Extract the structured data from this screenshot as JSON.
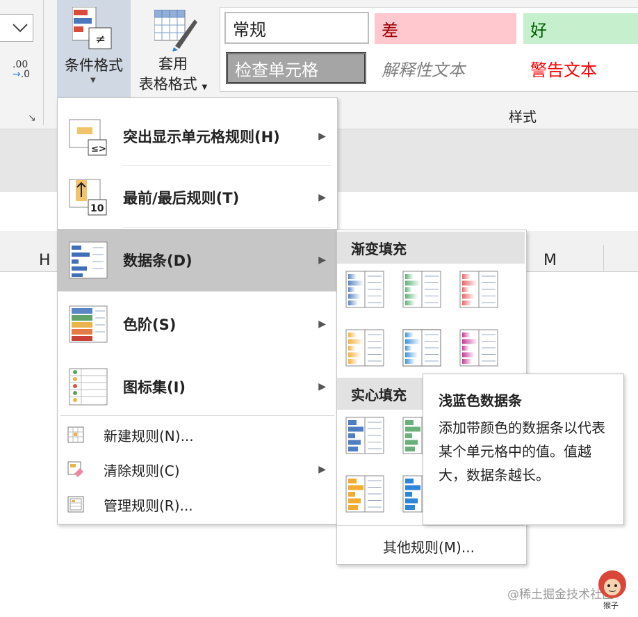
{
  "ribbon": {
    "cond_format_label": "条件格式",
    "table_format_line1": "套用",
    "table_format_line2": "表格格式",
    "styles_group_label": "样式",
    "decimal_label": ".00",
    "decimal_label2": ".0",
    "styles": {
      "normal": "常规",
      "bad": "差",
      "good": "好",
      "check_cell": "检查单元格",
      "explanatory": "解释性文本",
      "warning": "警告文本"
    }
  },
  "sheet": {
    "columns": [
      "H",
      "M"
    ]
  },
  "menu": {
    "items": [
      {
        "label": "突出显示单元格规则(H)",
        "icon": "highlight-cells-rules-icon"
      },
      {
        "label": "最前/最后规则(T)",
        "icon": "top-bottom-rules-icon"
      },
      {
        "label": "数据条(D)",
        "icon": "data-bars-icon"
      },
      {
        "label": "色阶(S)",
        "icon": "color-scales-icon"
      },
      {
        "label": "图标集(I)",
        "icon": "icon-sets-icon"
      }
    ],
    "small_items": [
      {
        "label": "新建规则(N)...",
        "icon": "new-rule-icon"
      },
      {
        "label": "清除规则(C)",
        "icon": "clear-rules-icon"
      },
      {
        "label": "管理规则(R)...",
        "icon": "manage-rules-icon"
      }
    ]
  },
  "submenu": {
    "gradient_title": "渐变填充",
    "solid_title": "实心填充",
    "more_rules": "其他规则(M)...",
    "gradient_colors": [
      "#5b86c5",
      "#5fb378",
      "#e8686a",
      "#f3b13a",
      "#3d93dd",
      "#c33b98"
    ],
    "solid_colors": [
      "#4f7fc2",
      "#69b07a",
      "#f2ad2e",
      "#2f86d8"
    ]
  },
  "tooltip": {
    "title": "浅蓝色数据条",
    "body": "添加带颜色的数据条以代表某个单元格中的值。值越大，数据条越长。"
  },
  "watermark": "@稀土掘金技术社区"
}
